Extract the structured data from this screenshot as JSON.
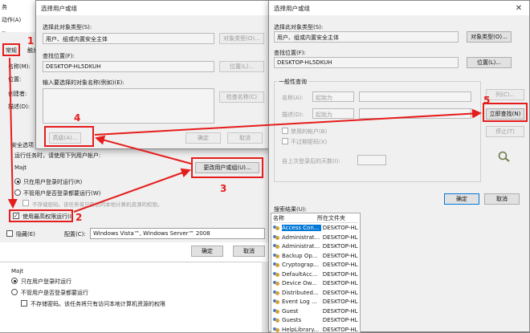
{
  "bg_window": {
    "title_fragment": "务",
    "menu_fragment": "动作(A)",
    "toolbar_fragment": "助",
    "tabs": [
      "常规",
      "触发"
    ],
    "side_labels": [
      "名称(M):",
      "位置:",
      "创建者:",
      "描述(D):"
    ],
    "security_options": "安全选项",
    "run_as_label": "运行任务时，请使用下列用户帐户:",
    "user": "Majt",
    "radio_logged_on": "只在用户登录时运行(R)",
    "radio_any": "不管用户是否登录都要运行(W)",
    "no_store_password": "不存储密码。该任务将只有访问本地计算机资源的权限。",
    "change_user_button": "更改用户或组(U)...",
    "highest_privileges": "使用最高权限运行(I)",
    "hidden": "隐藏(E)",
    "configure_label": "配置(C):",
    "configure_value": "Windows Vista™, Windows Server™ 2008",
    "ok_button": "确定",
    "cancel_button": "取消",
    "lower_user": "Majt",
    "lower_radio_logged_on": "只在用户登录时运行",
    "lower_radio_any": "不管用户是否登录都要运行",
    "lower_no_store": "不存储密码。该任务将只有访问本地计算机资源的权限"
  },
  "select_dialog": {
    "title": "选择用户或组",
    "object_type_label": "选择此对象类型(S):",
    "object_type_value": "用户、组或内置安全主体",
    "object_type_button": "对象类型(O)...",
    "location_label": "查找位置(F):",
    "location_value": "DESKTOP-HL5DKUH",
    "location_button": "位置(L)...",
    "enter_names_label": "输入要选择的对象名称(例如)(E):",
    "check_names_button": "检查名称(C)",
    "advanced_button": "高级(A)...",
    "ok_button": "确定",
    "cancel_button": "取消"
  },
  "advanced_dialog": {
    "title": "选择用户或组",
    "object_type_label": "选择此对象类型(S):",
    "object_type_value": "用户、组或内置安全主体",
    "object_type_button": "对象类型(O)...",
    "location_label": "查找位置(F):",
    "location_value": "DESKTOP-HL5DKUH",
    "location_button": "位置(L)...",
    "common_queries_tab": "一般性查询",
    "name_label": "名称(A):",
    "name_op": "起始为",
    "desc_label": "描述(D):",
    "desc_op": "起始为",
    "columns_button": "列(C)...",
    "find_now_button": "立即查找(N)",
    "stop_button": "停止(T)",
    "disabled_accounts": "禁用的帐户(B)",
    "non_expiring": "不过期密码(X)",
    "days_since_logon": "自上次登录后的天数(I):",
    "ok_button": "确定",
    "cancel_button": "取消",
    "results_label": "搜索结果(U):",
    "col_name": "名称",
    "col_folder": "所在文件夹",
    "results": [
      {
        "name": "Access Con...",
        "folder": "DESKTOP-HL..."
      },
      {
        "name": "Administrat...",
        "folder": "DESKTOP-HL..."
      },
      {
        "name": "Administrat...",
        "folder": "DESKTOP-HL..."
      },
      {
        "name": "Backup Op...",
        "folder": "DESKTOP-HL..."
      },
      {
        "name": "Cryptograp...",
        "folder": "DESKTOP-HL..."
      },
      {
        "name": "DefaultAcc...",
        "folder": "DESKTOP-HL..."
      },
      {
        "name": "Device Ow...",
        "folder": "DESKTOP-HL..."
      },
      {
        "name": "Distributed...",
        "folder": "DESKTOP-HL..."
      },
      {
        "name": "Event Log ...",
        "folder": "DESKTOP-HL..."
      },
      {
        "name": "Guest",
        "folder": "DESKTOP-HL..."
      },
      {
        "name": "Guests",
        "folder": "DESKTOP-HL..."
      },
      {
        "name": "HelpLibrary...",
        "folder": "DESKTOP-HL..."
      }
    ]
  },
  "annotations": {
    "n1": "1",
    "n2": "2",
    "n3": "3",
    "n4": "4",
    "n5": "5"
  },
  "colors": {
    "accent": "#0078d7",
    "annotation": "#e51c1c"
  }
}
